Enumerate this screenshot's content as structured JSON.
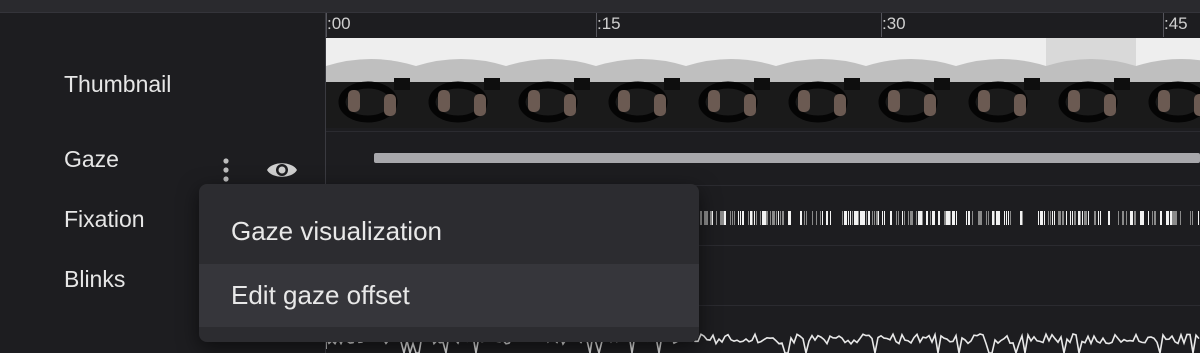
{
  "rows": {
    "thumbnail": "Thumbnail",
    "gaze": "Gaze",
    "fixation": "Fixation",
    "blinks": "Blinks"
  },
  "timeline": {
    "ticks": [
      ":00",
      ":15",
      ":30",
      ":45"
    ]
  },
  "context_menu": {
    "items": [
      "Gaze visualization",
      "Edit gaze offset"
    ],
    "highlighted_item": "Edit gaze offset"
  },
  "icons": {
    "more": "more-vertical-icon",
    "visibility": "eye-icon"
  },
  "colors": {
    "background": "#1d1d20",
    "menu_background": "#2c2c30",
    "gaze_bar": "#a8a8ac",
    "text": "#e6e6e6"
  }
}
